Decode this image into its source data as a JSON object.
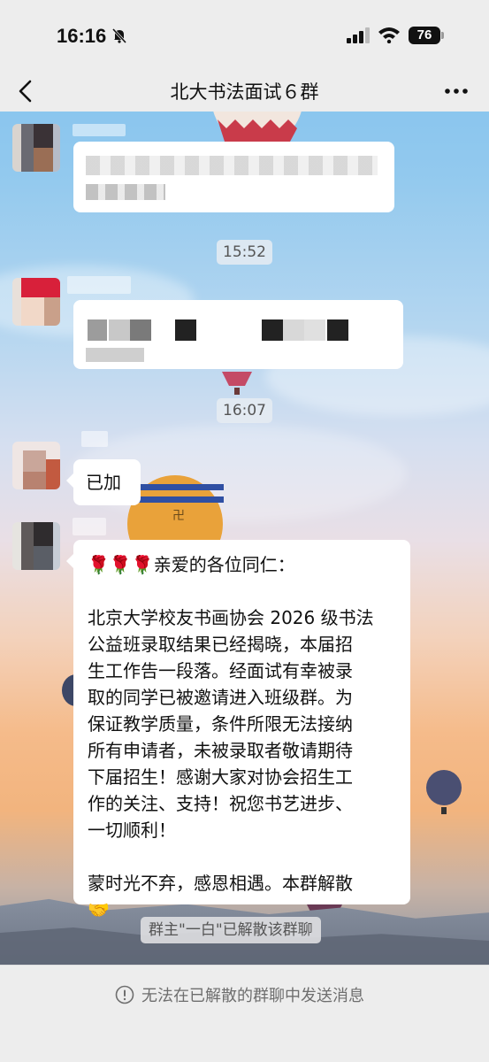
{
  "status_bar": {
    "time": "16:16",
    "battery": "76"
  },
  "header": {
    "title": "北大书法面试６群"
  },
  "messages": {
    "timestamp_1": "15:52",
    "timestamp_2": "16:07",
    "reply_text": "已加",
    "announcement": {
      "greeting": "🌹🌹🌹亲爱的各位同仁：",
      "line_1": "北京大学校友书画协会 2026 级书法",
      "line_2": "公益班录取结果已经揭晓，本届招",
      "line_3": "生工作告一段落。经面试有幸被录",
      "line_4": "取的同学已被邀请进入班级群。为",
      "line_5": "保证教学质量，条件所限无法接纳",
      "line_6": "所有申请者，未被录取者敬请期待",
      "line_7": "下届招生！感谢大家对协会招生工",
      "line_8": "作的关注、支持！祝您书艺进步、",
      "line_9": "一切顺利！",
      "closing": "蒙时光不弃，感恩相遇。本群解散",
      "emoji": "🤝"
    }
  },
  "system_note": "群主\"一白\"已解散该群聊",
  "footer": {
    "notice": "无法在已解散的群聊中发送消息"
  },
  "colors": {
    "bubble": "#ffffff",
    "nav_bg": "#ededed",
    "text": "#111111"
  }
}
